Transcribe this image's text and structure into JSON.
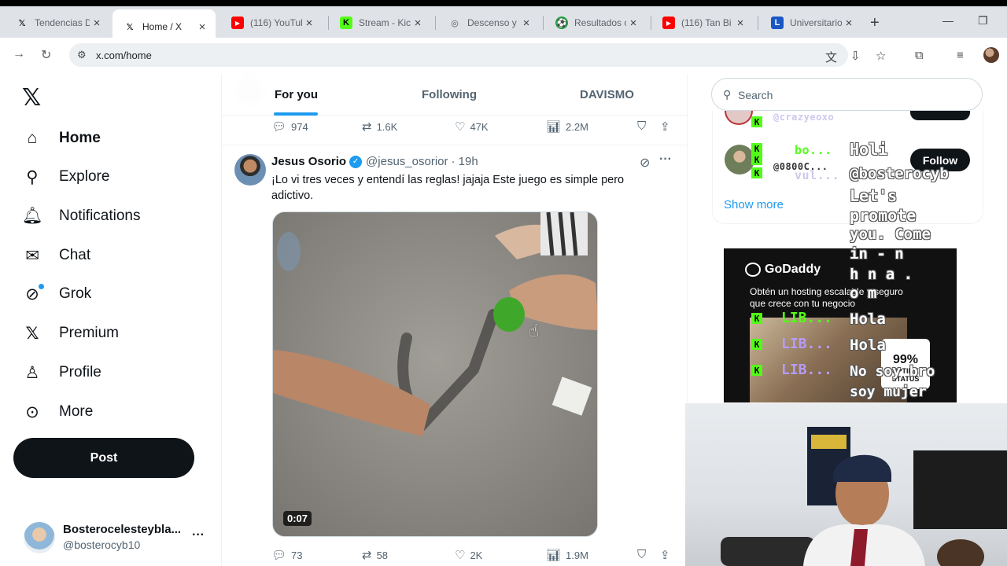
{
  "browser": {
    "tabs": [
      {
        "title": "Tendencias D",
        "favicon": "x-icon",
        "active": false
      },
      {
        "title": "Home / X",
        "favicon": "x-icon",
        "active": true
      },
      {
        "title": "(116) YouTub",
        "favicon": "youtube-icon",
        "active": false
      },
      {
        "title": "Stream - Kic",
        "favicon": "kick-icon",
        "active": false
      },
      {
        "title": "Descenso y",
        "favicon": "globe-icon",
        "active": false
      },
      {
        "title": "Resultados c",
        "favicon": "soccer-icon",
        "active": false
      },
      {
        "title": "(116) Tan Bi",
        "favicon": "youtube-icon",
        "active": false
      },
      {
        "title": "Universitario",
        "favicon": "l-icon",
        "active": false
      }
    ],
    "url": "x.com/home"
  },
  "nav": {
    "items": [
      {
        "label": "Home",
        "icon": "home-icon"
      },
      {
        "label": "Explore",
        "icon": "search-icon"
      },
      {
        "label": "Notifications",
        "icon": "bell-icon"
      },
      {
        "label": "Chat",
        "icon": "mail-icon"
      },
      {
        "label": "Grok",
        "icon": "grok-icon"
      },
      {
        "label": "Premium",
        "icon": "x-icon"
      },
      {
        "label": "Profile",
        "icon": "person-icon"
      },
      {
        "label": "More",
        "icon": "more-circle-icon"
      }
    ],
    "post_label": "Post",
    "account": {
      "name": "Bosterocelesteybla...",
      "handle": "@bosterocyb10"
    }
  },
  "feed": {
    "tabs": [
      "For you",
      "Following",
      "DAVISMO"
    ],
    "prev_tweet_stats": {
      "replies": "974",
      "reposts": "1.6K",
      "likes": "47K",
      "views": "2.2M"
    },
    "tweet": {
      "name": "Jesus Osorio",
      "handle": "@jesus_osorior",
      "time": "· 19h",
      "text": "¡Lo vi tres veces y entendí las reglas! jajaja Este juego es simple pero adictivo.",
      "video_duration": "0:07",
      "stats": {
        "replies": "73",
        "reposts": "58",
        "likes": "2K",
        "views": "1.9M"
      }
    }
  },
  "sidebar": {
    "search_placeholder": "Search",
    "follow_label": "Follow",
    "show_more": "Show more",
    "ad": {
      "brand": "GoDaddy",
      "copy": "Obtén un hosting escalable y seguro que crece con tu negocio",
      "uptime_pct": "99%",
      "uptime_label": "UPTIME STATUS"
    }
  },
  "overlay": {
    "chat_big": [
      "Holi",
      "@bosterocyb",
      "Let's",
      "promote",
      "you. Come",
      "in - n",
      "h n a .",
      "o m",
      "Hola",
      "Hola",
      "No soy bro",
      "soy mujer"
    ],
    "chat_small": [
      "@crazyeoxo",
      "bo...",
      "@0800C...",
      "vul..."
    ],
    "lib": [
      "LIB...",
      "LIB...",
      "LIB..."
    ]
  },
  "colors": {
    "accent": "#1d9bf0",
    "kick_green": "#53fc18",
    "text": "#0f1419",
    "muted": "#536471"
  }
}
